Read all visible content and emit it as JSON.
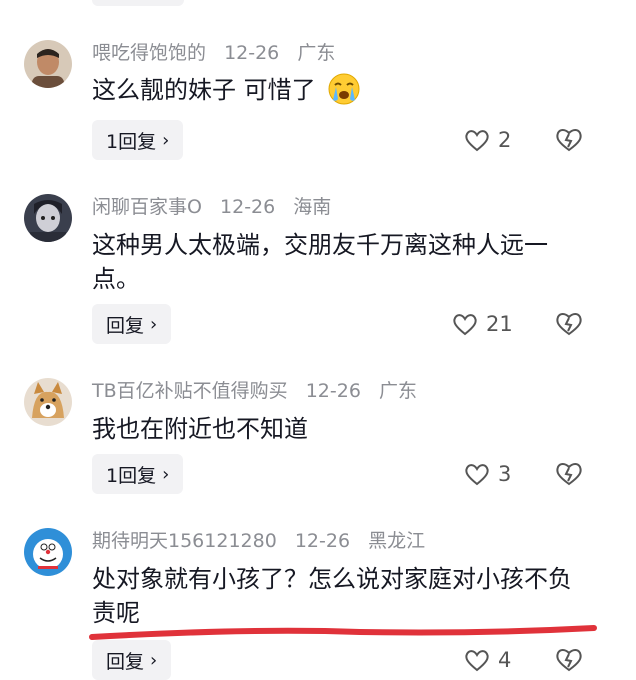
{
  "comments": [
    {
      "user": "喂吃得饱饱的",
      "date": "12-26",
      "location": "广东",
      "text": "这么靓的妹子 可惜了",
      "reply_label": "1回复",
      "likes": "2",
      "avatar_colors": [
        "#d7c9b8",
        "#6b4e3b"
      ]
    },
    {
      "user": "闲聊百家事O",
      "date": "12-26",
      "location": "海南",
      "text": "这种男人太极端，交朋友千万离这种人远一点。",
      "reply_label": "回复",
      "likes": "21",
      "avatar_colors": [
        "#4a4f5e",
        "#2a2d38"
      ]
    },
    {
      "user": "TB百亿补贴不值得购买",
      "date": "12-26",
      "location": "广东",
      "text": "我也在附近也不知道",
      "reply_label": "1回复",
      "likes": "3",
      "avatar_colors": [
        "#e2c08f",
        "#b4783f"
      ]
    },
    {
      "user": "期待明天156121280",
      "date": "12-26",
      "location": "黑龙江",
      "text": "处对象就有小孩了？怎么说对家庭对小孩不负责呢",
      "reply_label": "回复",
      "likes": "4",
      "avatar_colors": [
        "#2f8fd8",
        "#ffffff"
      ]
    }
  ],
  "emoji": "crying-face-emoji",
  "underline_color": "#e0323a"
}
